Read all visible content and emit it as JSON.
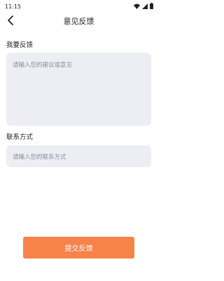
{
  "status_bar": {
    "time": "11:15",
    "icons": [
      "wifi-icon",
      "signal-icon",
      "battery-icon"
    ]
  },
  "header": {
    "title": "意见反馈",
    "back_icon": "chevron-left-icon"
  },
  "feedback": {
    "label": "我要反馈",
    "placeholder": "请输入您的建议或意见"
  },
  "contact": {
    "label": "联系方式",
    "placeholder": "请输入您的联系方式"
  },
  "actions": {
    "submit_label": "提交反馈"
  },
  "colors": {
    "accent": "#f7824a",
    "field_bg": "#eceef3",
    "placeholder": "#8a8f99"
  }
}
